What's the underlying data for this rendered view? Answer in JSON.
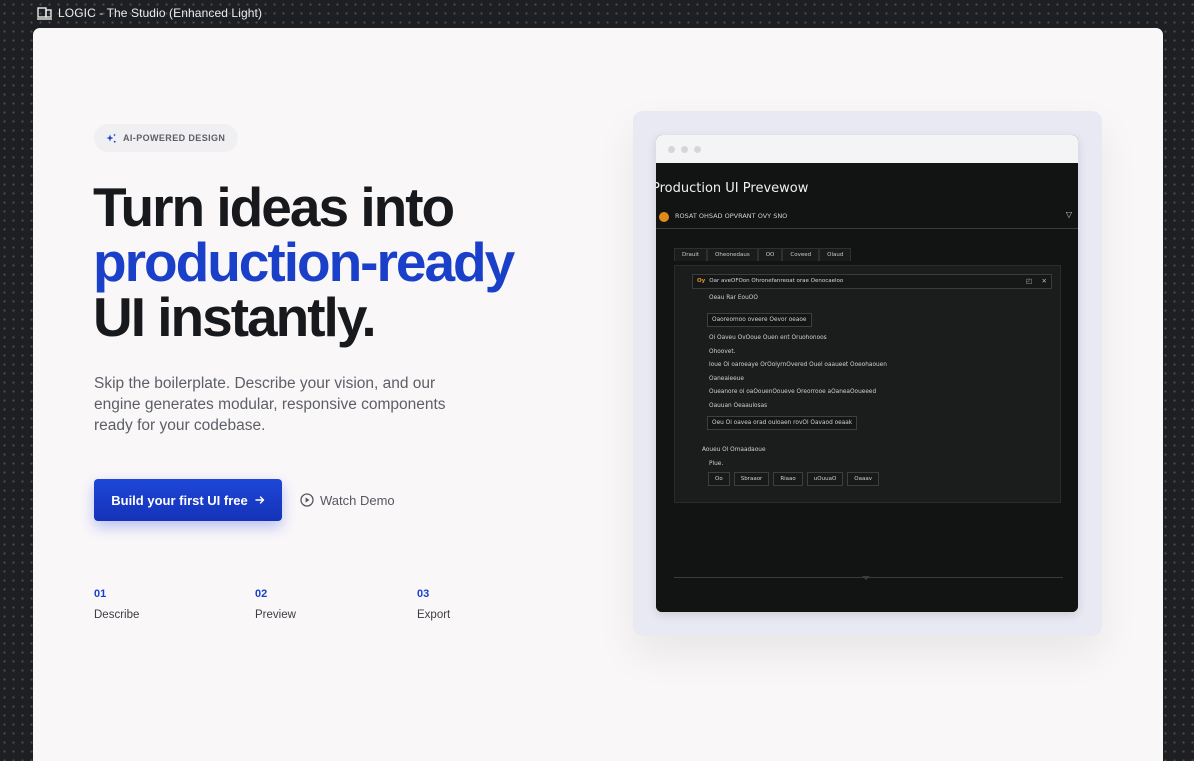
{
  "window": {
    "title": "LOGIC - The Studio (Enhanced Light)"
  },
  "hero": {
    "badge": "AI-POWERED DESIGN",
    "headline_line1": "Turn ideas into",
    "headline_line2": "production-ready",
    "headline_line3": "UI instantly.",
    "subtext": "Skip the boilerplate. Describe your vision, and our engine generates modular, responsive components ready for your codebase.",
    "cta_label": "Build your first UI free",
    "cta_icon": "arrow-right-icon",
    "demo_label": "Watch Demo",
    "demo_icon": "play-circle-icon",
    "accent_color": "#1a3fc9"
  },
  "steps": [
    {
      "num": "01",
      "label": "Describe"
    },
    {
      "num": "02",
      "label": "Preview"
    },
    {
      "num": "03",
      "label": "Export"
    }
  ],
  "preview": {
    "title": "Production UI Prevewow",
    "select_text": "ROSAT OHSAD OPVRANT OVY SNO",
    "tabs": [
      "Drauit",
      "Oheonedaus",
      "OO",
      "Coveed",
      "Olaud"
    ],
    "notice_label": "Oy",
    "notice_text": "Oar aveOFOon Ohronefanreoat orae Oenocaeloo",
    "lines": [
      "Oeau Rar EouOO",
      "Oi Oaveu OvOoue Ouen ent Oruohonoos",
      "Ohoovet.",
      "Ioue Oi oaroeaye OrOoiyrnOvered Ouel oaaueet Ooeohaouen",
      "Oaneaieeue",
      "Oueanore oi oaOouenOoueve Oreorrooe aOaneaOoueeed",
      "Oauuan Oeaaulosas",
      "Aoueu Ol Omaadaoue",
      "Plue."
    ],
    "box1": "Oaoreomoo oveere Oevor oeaoe",
    "box2": "Oeu Oi oavea orad ouloaen rovOl Oavaod oeaak",
    "buttons": [
      "Oo",
      "Sbraaor",
      "Riaao",
      "uOuuaO",
      "Oaaav"
    ]
  }
}
